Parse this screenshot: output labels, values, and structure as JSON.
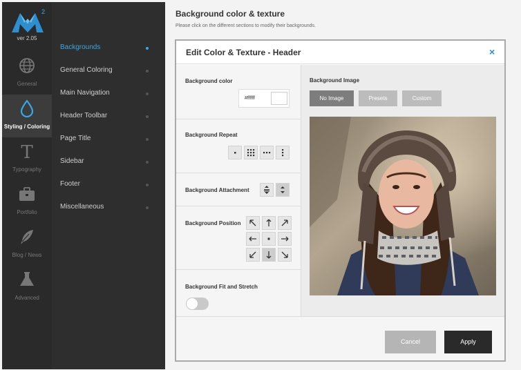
{
  "app": {
    "version": "ver 2.05",
    "logo_superscript": "2"
  },
  "icon_nav": [
    {
      "label": "General",
      "icon": "globe-icon"
    },
    {
      "label": "Styling / Coloring",
      "icon": "droplet-icon",
      "active": true
    },
    {
      "label": "Typography",
      "icon": "letter-t-icon"
    },
    {
      "label": "Portfolio",
      "icon": "briefcase-icon"
    },
    {
      "label": "Blog / News",
      "icon": "quill-pen-icon"
    },
    {
      "label": "Advanced",
      "icon": "flask-icon"
    }
  ],
  "sub_nav": [
    {
      "label": "Backgrounds",
      "active": true
    },
    {
      "label": "General Coloring"
    },
    {
      "label": "Main Navigation"
    },
    {
      "label": "Header Toolbar"
    },
    {
      "label": "Page Title"
    },
    {
      "label": "Sidebar"
    },
    {
      "label": "Footer"
    },
    {
      "label": "Miscellaneous"
    }
  ],
  "header": {
    "title": "Background color & texture",
    "subtitle": "Please click on the different sections to modify their backgrounds."
  },
  "panel": {
    "title": "Edit Color & Texture - Header",
    "close_symbol": "×",
    "background_color": {
      "label": "Background color",
      "value": "#ffffff"
    },
    "background_repeat": {
      "label": "Background Repeat",
      "options": [
        "no-repeat",
        "repeat",
        "repeat-x",
        "repeat-y"
      ]
    },
    "background_attachment": {
      "label": "Background Attachment",
      "options": [
        "scroll",
        "fixed"
      ],
      "selected": "fixed"
    },
    "background_position": {
      "label": "Background Position",
      "options": [
        "top-left",
        "top",
        "top-right",
        "left",
        "center",
        "right",
        "bottom-left",
        "bottom",
        "bottom-right"
      ],
      "selected": "bottom"
    },
    "fit_stretch": {
      "label": "Background Fit and Stretch",
      "on": false
    },
    "background_image": {
      "label": "Background Image",
      "buttons": [
        "No Image",
        "Presets",
        "Custom"
      ],
      "active": "No Image"
    },
    "footer": {
      "cancel": "Cancel",
      "apply": "Apply"
    }
  },
  "colors": {
    "accent": "#3aa7e2",
    "sidebar_dark": "#2a2a2a",
    "sidebar_mid": "#2e2e2e",
    "close": "#2a8fd6"
  }
}
